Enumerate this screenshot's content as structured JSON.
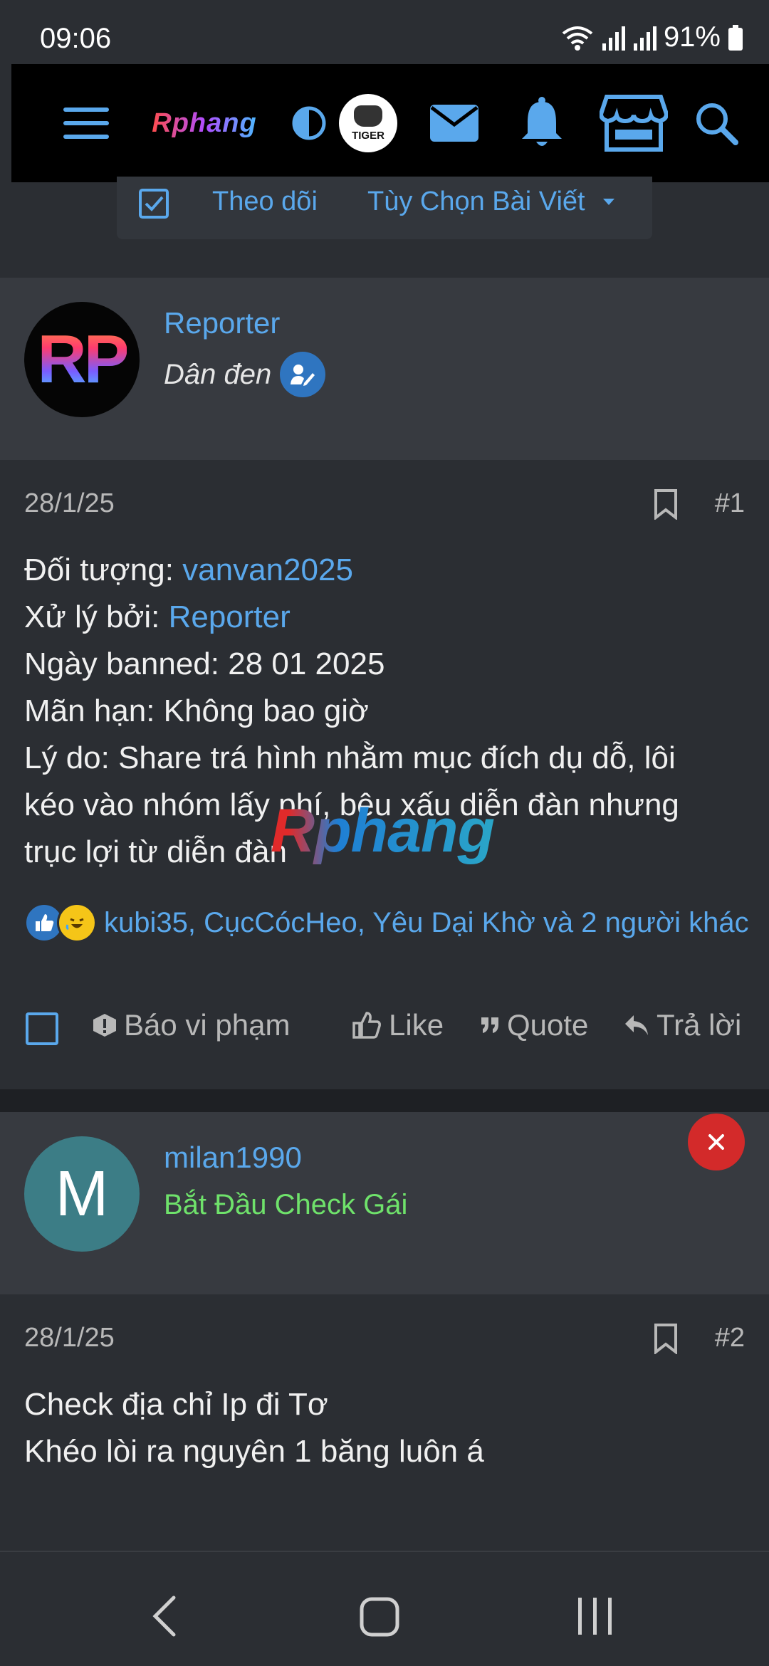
{
  "status_bar": {
    "time": "09:06",
    "battery": "91%"
  },
  "topnav": {
    "logo": "Rphang",
    "tiger_label": "TIGER"
  },
  "thread_tools": {
    "follow_label": "Theo dõi",
    "options_label": "Tùy Chọn Bài Viết"
  },
  "posts": [
    {
      "author": "Reporter",
      "avatar_initials": "RP",
      "user_title": "Dân đen",
      "date": "28/1/25",
      "number": "#1",
      "lines": [
        {
          "label": "Đối tượng: ",
          "link": "vanvan2025"
        },
        {
          "label": "Xử lý bởi: ",
          "link": "Reporter"
        },
        {
          "text": "Ngày banned: 28 01 2025"
        },
        {
          "text": "Mãn hạn: Không bao giờ"
        },
        {
          "text": "Lý do: Share trá hình nhằm mục đích dụ dỗ, lôi"
        },
        {
          "text": "kéo vào nhóm lấy phí, bêu xấu diễn đàn nhưng"
        },
        {
          "text": "trục lợi từ diễn đàn"
        }
      ],
      "reactions_text": "kubi35, CụcCócHeo, Yêu Dại Khờ và 2 người khác",
      "actions": {
        "report": "Báo vi phạm",
        "like": "Like",
        "quote": "Quote",
        "reply": "Trả lời"
      }
    },
    {
      "author": "milan1990",
      "avatar_initials": "M",
      "user_title": "Bắt Đầu Check Gái",
      "date": "28/1/25",
      "number": "#2",
      "lines": [
        {
          "text": "Check địa chỉ Ip đi Tơ"
        },
        {
          "text": "Khéo lòi ra nguyên 1 băng luôn á"
        }
      ]
    }
  ],
  "watermark": "Rphang",
  "colors": {
    "accent": "#5aa8ec",
    "background": "#2b2e33",
    "header_bg": "#373a40",
    "title_green": "#6fe26b",
    "close_red": "#d32a2a"
  }
}
